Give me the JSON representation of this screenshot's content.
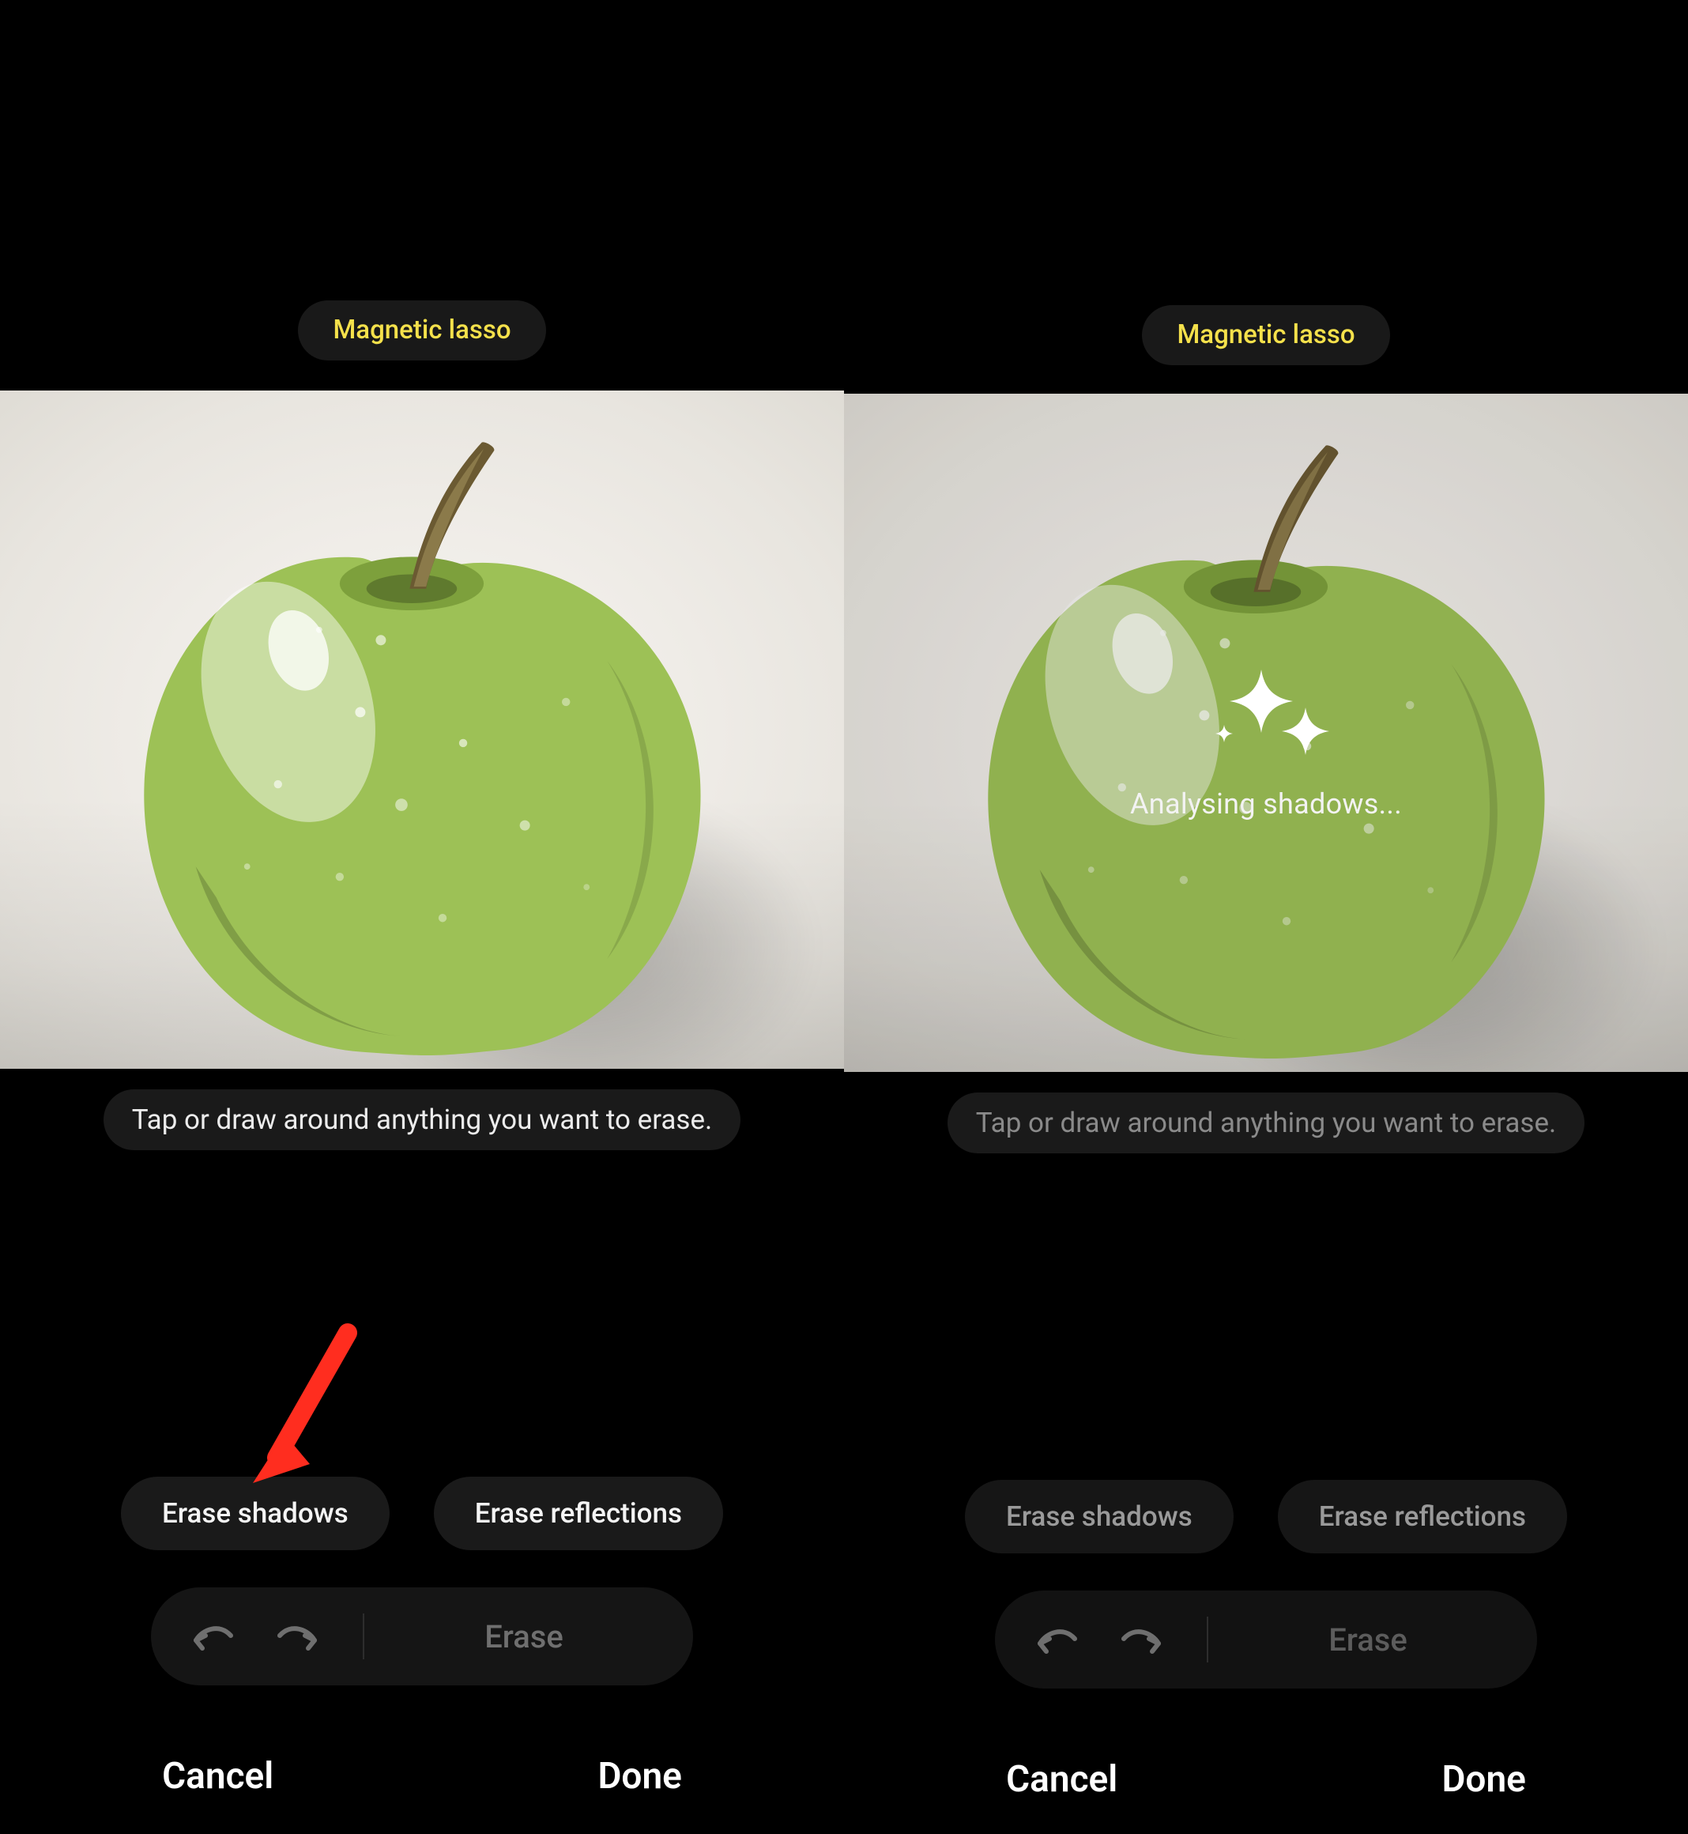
{
  "left": {
    "toolPill": "Magnetic lasso",
    "hint": "Tap or draw around anything you want to erase.",
    "actions": {
      "eraseShadows": "Erase shadows",
      "eraseReflections": "Erase reflections"
    },
    "toolbar": {
      "erase": "Erase"
    },
    "bottom": {
      "cancel": "Cancel",
      "done": "Done"
    }
  },
  "right": {
    "toolPill": "Magnetic lasso",
    "overlayText": "Analysing shadows...",
    "hint": "Tap or draw around anything you want to erase.",
    "actions": {
      "eraseShadows": "Erase shadows",
      "eraseReflections": "Erase reflections"
    },
    "toolbar": {
      "erase": "Erase"
    },
    "bottom": {
      "cancel": "Cancel",
      "done": "Done"
    }
  }
}
